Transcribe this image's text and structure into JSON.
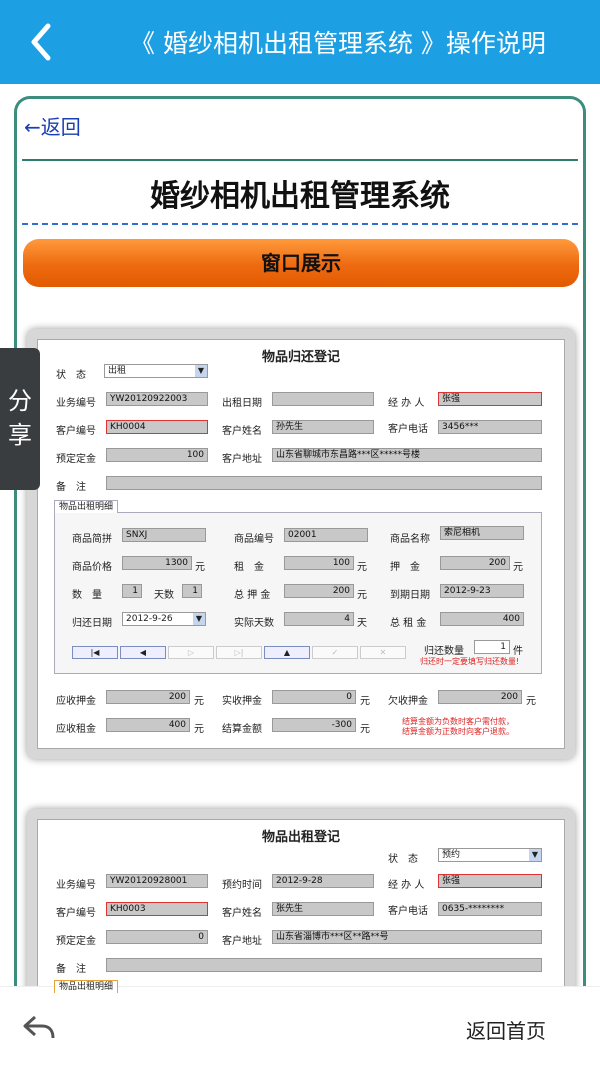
{
  "topbar": {
    "title": "《 婚纱相机出租管理系统 》操作说明",
    "back_icon": "chevron-left-icon",
    "color": "#1d9fe4"
  },
  "content": {
    "back_link": "←返回",
    "heading": "婚纱相机出租管理系统",
    "section_button": "窗口展示"
  },
  "share": {
    "label": "分享"
  },
  "return_window": {
    "title": "物品归还登记",
    "status_label": "状　态",
    "status_value": "出租",
    "biz_no_label": "业务编号",
    "biz_no": "YW20120922003",
    "rent_date_label": "出租日期",
    "rent_date": "",
    "handler_label": "经 办 人",
    "handler": "张强",
    "cust_no_label": "客户编号",
    "cust_no": "KH0004",
    "cust_name_label": "客户姓名",
    "cust_name": "孙先生",
    "cust_phone_label": "客户电话",
    "cust_phone": "3456***",
    "deposit_label": "预定定金",
    "deposit": "100",
    "addr_label": "客户地址",
    "addr": "山东省聊城市东昌路***区*****号楼",
    "memo_label": "备　注",
    "tab_label": "物品出租明细",
    "abbr_label": "商品简拼",
    "abbr": "SNXJ",
    "code_label": "商品编号",
    "code": "02001",
    "name_label": "商品名称",
    "name": "索尼相机",
    "price_label": "商品价格",
    "price": "1300",
    "rent_label": "租　金",
    "rent": "100",
    "pledge_label": "押　金",
    "pledge": "200",
    "qty_label": "数　量",
    "qty": "1",
    "days_label": "天数",
    "days": "1",
    "total_pledge_label": "总 押 金",
    "total_pledge": "200",
    "due_label": "到期日期",
    "due": "2012-9-23",
    "ret_date_label": "归还日期",
    "ret_date": "2012-9-26",
    "actual_days_label": "实际天数",
    "actual_days": "4",
    "total_rent_label": "总 租 金",
    "total_rent": "400",
    "ret_qty_label": "归还数量",
    "ret_qty": "1",
    "unit_piece": "件",
    "ret_note": "归还时一定要填写归还数量!",
    "yuan": "元",
    "day_unit": "天",
    "due_pledge_label": "应收押金",
    "due_pledge": "200",
    "paid_pledge_label": "实收押金",
    "paid_pledge": "0",
    "owed_pledge_label": "欠收押金",
    "owed_pledge": "200",
    "due_rent_label": "应收租金",
    "due_rent": "400",
    "settle_label": "结算金额",
    "settle": "-300",
    "settle_note1": "结算金额为负数时客户需付款，",
    "settle_note2": "结算金额为正数时向客户退款。"
  },
  "rent_window": {
    "title": "物品出租登记",
    "status_label": "状　态",
    "status_value": "预约",
    "biz_no_label": "业务编号",
    "biz_no": "YW20120928001",
    "book_label": "预约时间",
    "book": "2012-9-28",
    "handler_label": "经 办 人",
    "handler": "张强",
    "cust_no_label": "客户编号",
    "cust_no": "KH0003",
    "cust_name_label": "客户姓名",
    "cust_name": "张先生",
    "cust_phone_label": "客户电话",
    "cust_phone": "0635-********",
    "deposit_label": "预定定金",
    "deposit": "0",
    "addr_label": "客户地址",
    "addr": "山东省淄博市***区**路**号",
    "memo_label": "备　注",
    "tab_label": "物品出租明细"
  },
  "bottombar": {
    "back_icon": "return-arrow-icon",
    "home_label": "返回首页"
  }
}
